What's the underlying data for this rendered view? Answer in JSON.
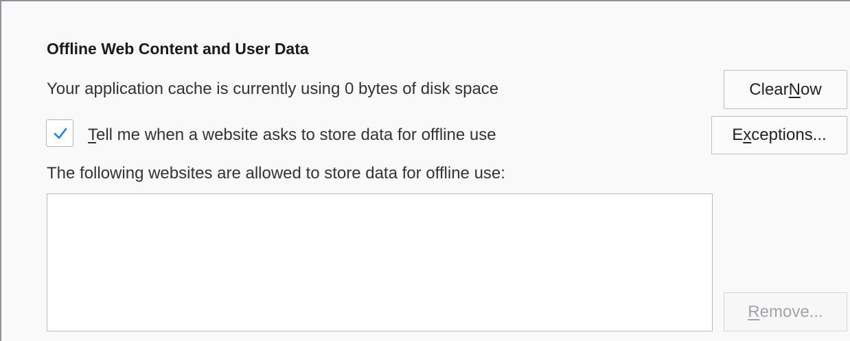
{
  "section": {
    "title": "Offline Web Content and User Data"
  },
  "cache": {
    "usage_text": "Your application cache is currently using 0 bytes of disk space",
    "clear_button": {
      "before": "Clear ",
      "accesskey": "N",
      "after": "ow"
    }
  },
  "notify": {
    "checked": true,
    "label": {
      "accesskey": "T",
      "after": "ell me when a website asks to store data for offline use"
    },
    "exceptions_button": {
      "before": "E",
      "accesskey": "x",
      "after": "ceptions..."
    }
  },
  "allowed_sites": {
    "caption": "The following websites are allowed to store data for offline use:",
    "items": [],
    "remove_button": {
      "accesskey": "R",
      "after": "emove...",
      "disabled": true
    }
  },
  "colors": {
    "check_accent": "#0a84ff",
    "background": "#f9f9fa"
  }
}
